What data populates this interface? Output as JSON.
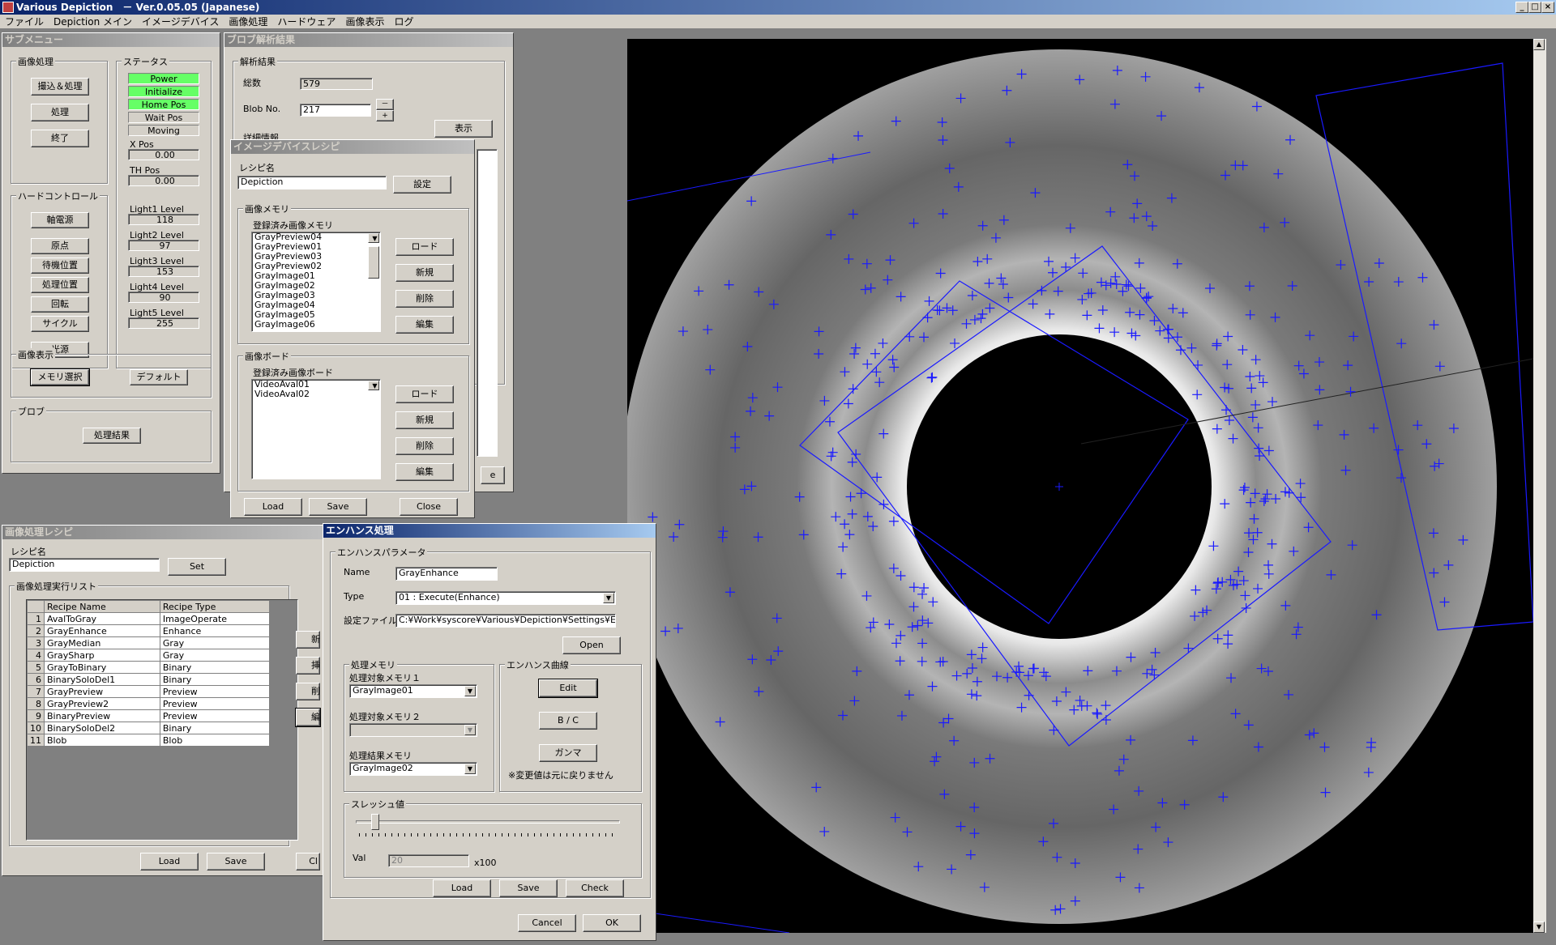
{
  "window": {
    "title": "Various Depiction　－ Ver.0.05.05 (Japanese)",
    "min": "_",
    "max": "□",
    "close": "×"
  },
  "menu": [
    "ファイル",
    "Depiction メイン",
    "イメージデバイス",
    "画像処理",
    "ハードウェア",
    "画像表示",
    "ログ"
  ],
  "submenu": {
    "title": "サブメニュー",
    "image_processing": {
      "label": "画像処理",
      "buttons": [
        "撮込＆処理",
        "処理",
        "終了"
      ]
    },
    "status": {
      "label": "ステータス",
      "items": [
        {
          "text": "Power",
          "on": true
        },
        {
          "text": "Initialize",
          "on": true
        },
        {
          "text": "Home Pos",
          "on": true
        },
        {
          "text": "Wait Pos",
          "on": false
        },
        {
          "text": "Moving",
          "on": false
        }
      ],
      "fields": [
        {
          "label": "X Pos",
          "value": "0.00"
        },
        {
          "label": "TH Pos",
          "value": "0.00"
        },
        {
          "label": "Light1 Level",
          "value": "118"
        },
        {
          "label": "Light2 Level",
          "value": "97"
        },
        {
          "label": "Light3 Level",
          "value": "153"
        },
        {
          "label": "Light4 Level",
          "value": "90"
        },
        {
          "label": "Light5 Level",
          "value": "255"
        }
      ]
    },
    "hard_control": {
      "label": "ハードコントロール",
      "buttons": [
        "軸電源",
        "原点",
        "待機位置",
        "処理位置",
        "回転",
        "サイクル",
        "光源"
      ]
    },
    "image_display": {
      "label": "画像表示",
      "buttons": [
        "メモリ選択",
        "デフォルト"
      ]
    },
    "blob": {
      "label": "ブロブ",
      "button": "処理結果"
    }
  },
  "blob_result": {
    "title": "ブロブ解析結果",
    "group": "解析結果",
    "total_label": "総数",
    "total_value": "579",
    "blob_no_label": "Blob No.",
    "blob_no_value": "217",
    "show_button": "表示",
    "detail_label": "詳細情報",
    "spin_up": "－",
    "spin_down": "+",
    "partial_btn": "e"
  },
  "image_device": {
    "title": "イメージデバイスレシピ",
    "recipe_label": "レシピ名",
    "recipe_value": "Depiction",
    "set_button": "設定",
    "memory_group": "画像メモリ",
    "memory_list_label": "登録済み画像メモリ",
    "memory_items": [
      "GrayPreview04",
      "GrayPreview01",
      "GrayPreview03",
      "GrayPreview02",
      "GrayImage01",
      "GrayImage02",
      "GrayImage03",
      "GrayImage04",
      "GrayImage05",
      "GrayImage06"
    ],
    "board_group": "画像ボード",
    "board_list_label": "登録済み画像ボード",
    "board_items": [
      "VideoAval01",
      "VideoAval02"
    ],
    "side_buttons": [
      "ロード",
      "新規",
      "削除",
      "編集"
    ],
    "bottom_buttons": [
      "Load",
      "Save",
      "Close"
    ]
  },
  "process_recipe": {
    "title": "画像処理レシピ",
    "recipe_label": "レシピ名",
    "recipe_value": "Depiction",
    "set_button": "Set",
    "list_label": "画像処理実行リスト",
    "columns": [
      "Recipe Name",
      "Recipe Type"
    ],
    "rows": [
      {
        "no": "1",
        "name": "AvalToGray",
        "type": "ImageOperate"
      },
      {
        "no": "2",
        "name": "GrayEnhance",
        "type": "Enhance"
      },
      {
        "no": "3",
        "name": "GrayMedian",
        "type": "Gray"
      },
      {
        "no": "4",
        "name": "GraySharp",
        "type": "Gray"
      },
      {
        "no": "5",
        "name": "GrayToBinary",
        "type": "Binary"
      },
      {
        "no": "6",
        "name": "BinarySoloDel1",
        "type": "Binary"
      },
      {
        "no": "7",
        "name": "GrayPreview",
        "type": "Preview"
      },
      {
        "no": "8",
        "name": "GrayPreview2",
        "type": "Preview"
      },
      {
        "no": "9",
        "name": "BinaryPreview",
        "type": "Preview"
      },
      {
        "no": "10",
        "name": "BinarySoloDel2",
        "type": "Binary"
      },
      {
        "no": "11",
        "name": "Blob",
        "type": "Blob"
      }
    ],
    "side_partial": [
      "新",
      "挿",
      "削",
      "編"
    ],
    "bottom_buttons": [
      "Load",
      "Save",
      "Cl"
    ]
  },
  "enhance": {
    "title": "エンハンス処理",
    "param_group": "エンハンスパラメータ",
    "name_label": "Name",
    "name_value": "GrayEnhance",
    "type_label": "Type",
    "type_value": "01 : Execute(Enhance)",
    "file_label": "設定ファイル",
    "file_value": "C:¥Work¥syscore¥Various¥Depiction¥Settings¥Enhan",
    "open_button": "Open",
    "memory_group": "処理メモリ",
    "mem1_label": "処理対象メモリ１",
    "mem1_value": "GrayImage01",
    "mem2_label": "処理対象メモリ２",
    "mem2_value": "",
    "result_label": "処理結果メモリ",
    "result_value": "GrayImage02",
    "curve_group": "エンハンス曲線",
    "curve_buttons": [
      "Edit",
      "B / C",
      "ガンマ"
    ],
    "curve_note": "※変更値は元に戻りません",
    "thresh_group": "スレッシュ値",
    "slider_value": 0.06,
    "val_label": "Val",
    "val_value": "20",
    "val_unit": "x100",
    "bottom_buttons": [
      "Load",
      "Save",
      "Check"
    ],
    "cancel": "Cancel",
    "ok": "OK"
  },
  "image_view": {
    "ring_color": "#c8c8c8",
    "marker_color": "#1a1aff"
  }
}
